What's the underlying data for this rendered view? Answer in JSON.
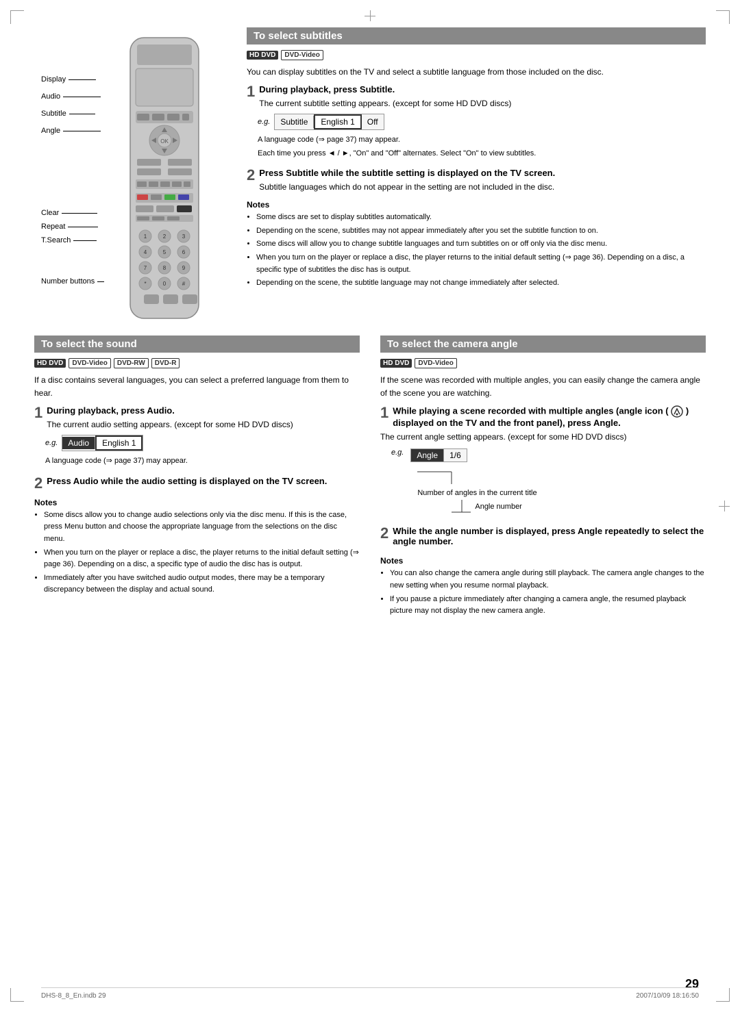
{
  "page": {
    "number": "29",
    "footer_left": "DHS-8_8_En.indb   29",
    "footer_right": "2007/10/09   18:16:50"
  },
  "subtitles_section": {
    "title": "To select subtitles",
    "badges": [
      "HD DVD",
      "DVD-Video"
    ],
    "intro": "You can display subtitles on the TV and select a subtitle language from those included on the disc.",
    "step1": {
      "number": "1",
      "title": "During playback, press Subtitle.",
      "body": "The current subtitle setting appears. (except for some HD DVD discs)",
      "eg_label": "e.g.",
      "display": [
        "Subtitle",
        "English 1",
        "Off"
      ],
      "display_highlighted": 1,
      "note1": "A language code (⇒ page 37) may appear.",
      "note2": "Each time you press ◄ / ►, \"On\" and \"Off\" alternates. Select \"On\" to view subtitles."
    },
    "step2": {
      "number": "2",
      "title": "Press Subtitle while the subtitle setting is displayed on the TV screen.",
      "body": "Subtitle languages which do not appear in the setting are not included in the disc."
    },
    "notes_title": "Notes",
    "notes": [
      "Some discs are set to display subtitles automatically.",
      "Depending on the scene, subtitles may not appear immediately after you set the subtitle function to on.",
      "Some discs will allow you to change subtitle languages and turn subtitles on or off only via the disc menu.",
      "When you turn on the player or replace a disc, the player returns to the initial default setting (⇒ page 36). Depending on a disc, a specific type of subtitles the disc has is output.",
      "Depending on the scene, the subtitle language may not change immediately after selected."
    ]
  },
  "sound_section": {
    "title": "To select the sound",
    "badges": [
      "HD DVD",
      "DVD-Video",
      "DVD-RW",
      "DVD-R"
    ],
    "intro": "If a disc contains several languages, you can select a preferred language from them to hear.",
    "step1": {
      "number": "1",
      "title": "During playback, press Audio.",
      "body": "The current audio setting appears. (except for some HD DVD discs)",
      "eg_label": "e.g.",
      "display": [
        "Audio",
        "English 1"
      ],
      "display_highlighted": 1,
      "note1": "A language code (⇒ page 37) may appear."
    },
    "step2": {
      "number": "2",
      "title": "Press Audio while the audio setting is displayed on the TV screen."
    },
    "notes_title": "Notes",
    "notes": [
      "Some discs allow you to change audio selections only via the disc menu. If this is the case, press Menu button and choose the appropriate language from the selections on the disc menu.",
      "When you turn on the player or replace a disc, the player returns to the initial default setting (⇒ page 36). Depending on a disc, a specific type of audio the disc has is output.",
      "Immediately after you have switched audio output modes, there may be a temporary discrepancy between the display and actual sound."
    ]
  },
  "camera_section": {
    "title": "To select the camera angle",
    "badges": [
      "HD DVD",
      "DVD-Video"
    ],
    "intro": "If the scene was recorded with multiple angles, you can easily change the camera angle of the scene you are watching.",
    "step1": {
      "number": "1",
      "title": "While playing a scene recorded with multiple angles (angle icon (",
      "title2": ") displayed on the TV and the front panel), press Angle.",
      "body": "The current angle setting appears. (except for some HD DVD discs)",
      "eg_label": "e.g.",
      "display": [
        "Angle",
        "1/6"
      ],
      "display_highlighted": 1,
      "annotation1": "Number of angles in the current title",
      "annotation2": "Angle number"
    },
    "step2": {
      "number": "2",
      "title": "While the angle number is displayed, press Angle repeatedly to select the angle number."
    },
    "notes_title": "Notes",
    "notes": [
      "You can also change the camera angle during still playback. The camera angle changes to the new setting when you resume normal playback.",
      "If you pause a picture immediately after changing a camera angle, the resumed playback picture may not display the new camera angle."
    ]
  },
  "remote": {
    "labels": {
      "display": "Display",
      "audio": "Audio",
      "subtitle": "Subtitle",
      "angle": "Angle",
      "clear": "Clear",
      "repeat": "Repeat",
      "tsearch": "T.Search",
      "number_buttons": "Number buttons"
    }
  }
}
